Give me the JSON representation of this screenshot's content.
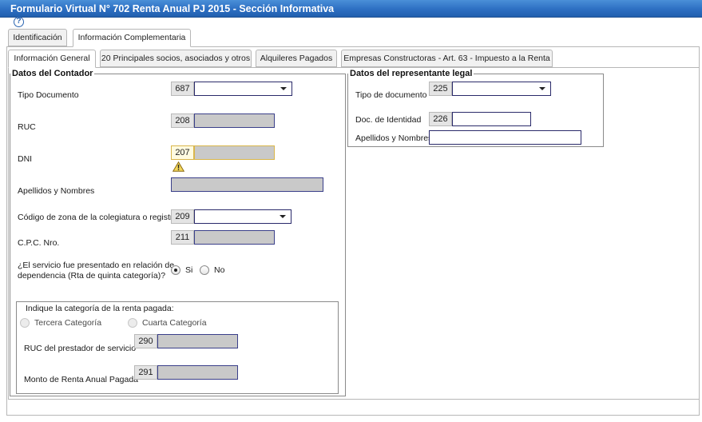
{
  "window": {
    "title": "Formulario Virtual N° 702 Renta Anual PJ 2015 - Sección Informativa"
  },
  "help": {
    "icon": "?"
  },
  "top_tabs": [
    {
      "label": "Identificación",
      "active": false
    },
    {
      "label": "Información Complementaria",
      "active": true
    }
  ],
  "sub_tabs": [
    {
      "label": "Información General",
      "active": true
    },
    {
      "label": "20 Principales socios, asociados y otros",
      "active": false
    },
    {
      "label": "Alquileres Pagados",
      "active": false
    },
    {
      "label": "Empresas Constructoras - Art. 63 - Impuesto a la Renta",
      "active": false
    }
  ],
  "contador": {
    "legend": "Datos del Contador",
    "tipo_documento": {
      "label": "Tipo Documento",
      "code": "687",
      "value": ""
    },
    "ruc": {
      "label": "RUC",
      "code": "208",
      "value": ""
    },
    "dni": {
      "label": "DNI",
      "code": "207",
      "value": ""
    },
    "apellidos": {
      "label": "Apellidos y Nombres",
      "value": ""
    },
    "colegiatura": {
      "label": "Código de zona de la colegiatura o registro",
      "code": "209",
      "value": ""
    },
    "cpc": {
      "label": "C.P.C. Nro.",
      "code": "211",
      "value": ""
    },
    "servicio": {
      "question_line1": "¿El servicio fue presentado en relación de",
      "question_line2": "dependencia (Rta de quinta categoría)?",
      "option_yes": "Si",
      "option_no": "No",
      "selected": "Si"
    },
    "categoria": {
      "title": "Indique la categoría de la renta pagada:",
      "option_tercera": "Tercera Categoría",
      "option_cuarta": "Cuarta Categoría",
      "ruc_prestador": {
        "label": "RUC del prestador de servicio",
        "code": "290",
        "value": ""
      },
      "monto_renta": {
        "label": "Monto de Renta Anual Pagada",
        "code": "291",
        "value": ""
      }
    }
  },
  "representante": {
    "legend": "Datos del representante legal",
    "tipo_documento": {
      "label": "Tipo de documento",
      "code": "225",
      "value": ""
    },
    "doc_identidad": {
      "label": "Doc. de Identidad",
      "code": "226",
      "value": ""
    },
    "apellidos": {
      "label": "Apellidos y Nombres",
      "value": ""
    }
  },
  "colors": {
    "titlebar": "#2d6fc2",
    "field_border": "#3a3f8a",
    "warning": "#d9b64a"
  }
}
